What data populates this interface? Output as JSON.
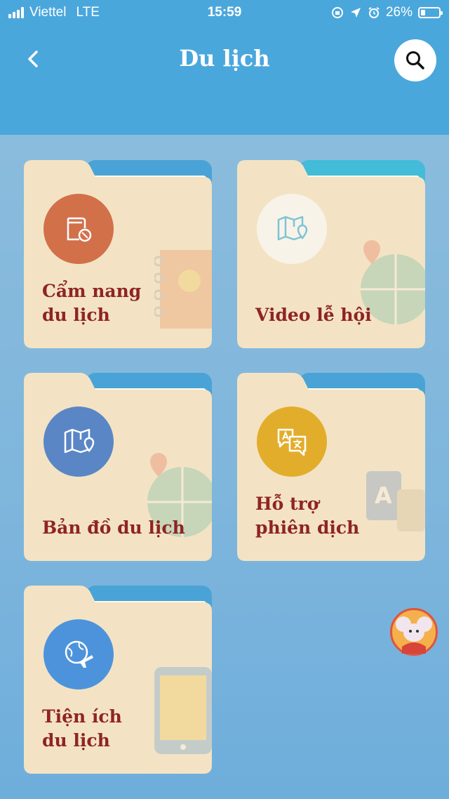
{
  "status_bar": {
    "carrier": "Viettel",
    "network": "LTE",
    "time": "15:59",
    "battery": "26%"
  },
  "header": {
    "title": "Du lịch",
    "back_icon": "chevron-left-icon",
    "search_icon": "search-icon"
  },
  "categories": [
    {
      "label": "Cẩm nang\ndu lịch",
      "icon": "guidebook-icon",
      "badge_color": "#d2704a"
    },
    {
      "label": "Video lễ hội",
      "icon": "folded-map-pin-icon",
      "badge_color": "#f8f3e8"
    },
    {
      "label": "Bản đồ du lịch",
      "icon": "folded-map-pin-icon",
      "badge_color": "#5a86c6"
    },
    {
      "label": "Hỗ trợ\nphiên dịch",
      "icon": "translate-chat-icon",
      "badge_color": "#e3ad2c"
    },
    {
      "label": "Tiện ích\ndu lịch",
      "icon": "globe-plane-icon",
      "badge_color": "#4d93dc"
    }
  ],
  "colors": {
    "header_bg": "#4aa7dc",
    "folder_body": "#f3e3c4",
    "folder_back_tab": "#4aa3d6",
    "label_text": "#8f2424"
  },
  "mascot": {
    "icon": "mouse-mascot-icon"
  }
}
